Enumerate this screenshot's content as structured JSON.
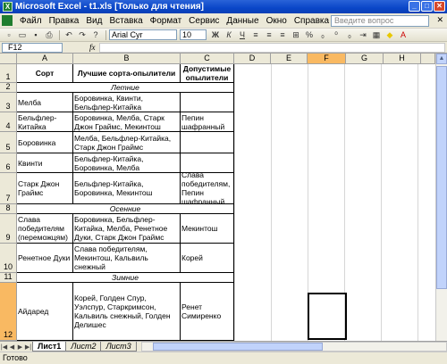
{
  "window": {
    "title": "Microsoft Excel - t1.xls  [Только для чтения]"
  },
  "menu": {
    "items": [
      "Файл",
      "Правка",
      "Вид",
      "Вставка",
      "Формат",
      "Сервис",
      "Данные",
      "Окно",
      "Справка"
    ],
    "help_placeholder": "Введите вопрос"
  },
  "toolbar": {
    "font_name": "Arial Cyr",
    "font_size": "10"
  },
  "formula_bar": {
    "name_box": "F12",
    "fx_label": "fx"
  },
  "columns": [
    "A",
    "B",
    "C",
    "D",
    "E",
    "F",
    "G",
    "H"
  ],
  "selected_column": "F",
  "selected_row": "12",
  "rows": [
    "1",
    "2",
    "3",
    "4",
    "5",
    "6",
    "7",
    "8",
    "9",
    "10",
    "11",
    "12"
  ],
  "table": {
    "header": {
      "a": "Сорт",
      "b": "Лучшие сорта-опылители",
      "c": "Допустимые опылители"
    },
    "sections": {
      "summer": "Летние",
      "autumn": "Осенние",
      "winter": "Зимние"
    },
    "r3": {
      "a": "Мелба",
      "b": "Боровинка, Квинти, Бельфлер-Китайка",
      "c": ""
    },
    "r4": {
      "a": "Бельфлер-Китайка",
      "b": "Боровинка, Мелба, Старк Джон Граймс, Мекинтош",
      "c": "Пепин шафранный"
    },
    "r5": {
      "a": "Боровинка",
      "b": "Мелба, Бельфлер-Китайка, Старк Джон Граймс",
      "c": ""
    },
    "r6": {
      "a": "Квинти",
      "b": "Бельфлер-Китайка, Боровинка, Мелба",
      "c": ""
    },
    "r7": {
      "a": "Старк Джон Граймс",
      "b": "Бельфлер-Китайка, Боровинка, Мекинтош",
      "c": "Слава победителям, Пепин шафранный"
    },
    "r9": {
      "a": "Слава победителям (переможцям)",
      "b": "Боровинка, Бельфлер-Китайка, Мелба, Ренетное Дуки, Старк Джон Граймс",
      "c": "Мекинтош"
    },
    "r10": {
      "a": "Ренетное Дуки",
      "b": "Слава победителям, Мекинтош, Кальвиль снежный",
      "c": "Корей"
    },
    "r12": {
      "a": "Айдаред",
      "b": "Корей, Голден Спур, Уэлспур, Старкримсон, Кальвиль снежный, Голден Делишес",
      "c": "Ренет Симиренко"
    }
  },
  "sheets": [
    "Лист1",
    "Лист2",
    "Лист3"
  ],
  "status": "Готово"
}
